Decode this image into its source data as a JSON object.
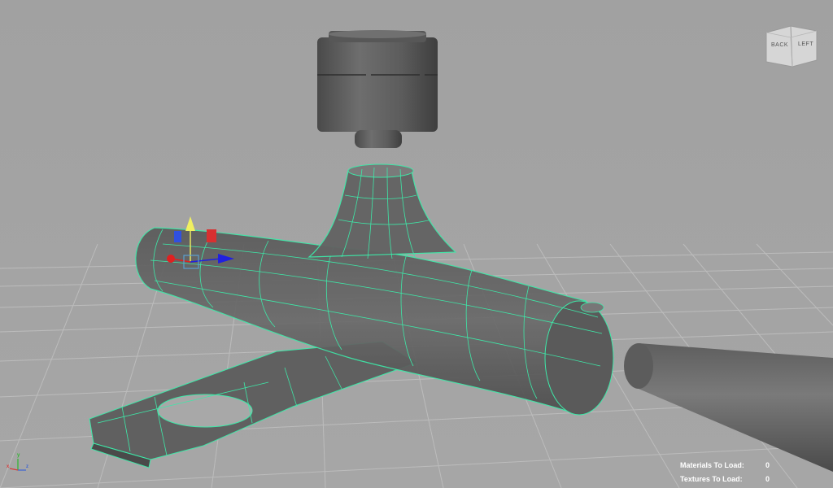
{
  "viewcube": {
    "back_label": "BACK",
    "left_label": "LEFT"
  },
  "hud": {
    "materials_label": "Materials To Load:",
    "materials_value": "0",
    "textures_label": "Textures To Load:",
    "textures_value": "0"
  },
  "axis_indicator": {
    "x_label": "x",
    "y_label": "y",
    "z_label": "z"
  },
  "colors": {
    "background": "#a3a3a3",
    "grid": "#bdbdbd",
    "wireframe": "#3ee8a8",
    "axis_x": "#e02020",
    "axis_y": "#f0f060",
    "axis_z": "#2020e0"
  }
}
